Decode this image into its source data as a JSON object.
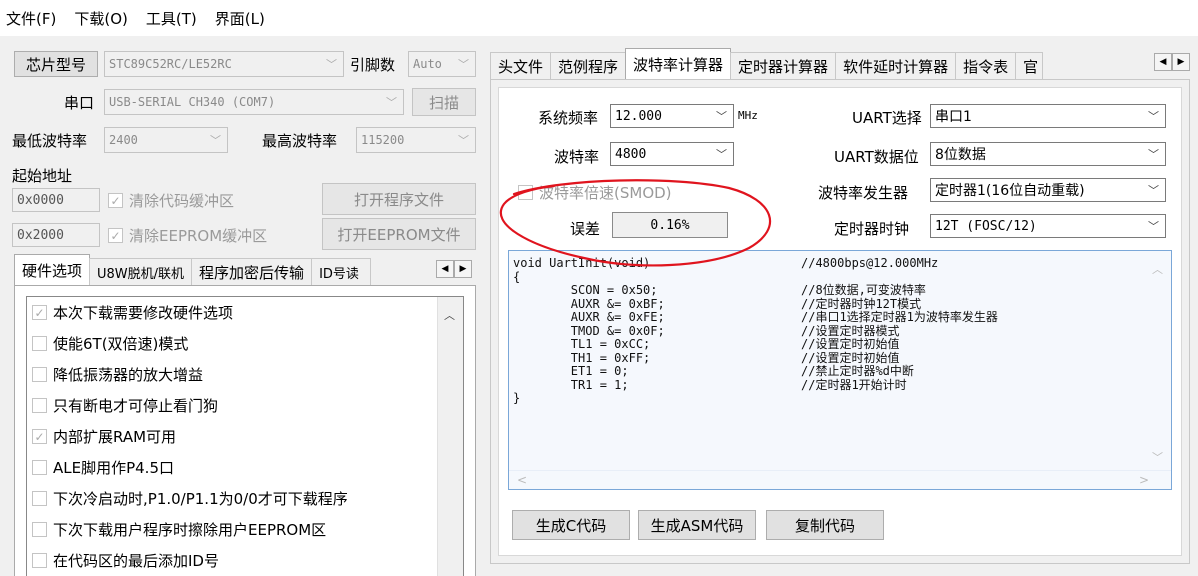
{
  "menu": [
    "文件(F)",
    "下载(O)",
    "工具(T)",
    "界面(L)"
  ],
  "left": {
    "chip_label": "芯片型号",
    "chip_value": "STC89C52RC/LE52RC",
    "pin_label": "引脚数",
    "pin_value": "Auto",
    "port_label": "串口",
    "port_value": "USB-SERIAL CH340 (COM7)",
    "scan_button": "扫描",
    "min_baud_label": "最低波特率",
    "min_baud_value": "2400",
    "max_baud_label": "最高波特率",
    "max_baud_value": "115200",
    "start_addr_label": "起始地址",
    "addr1": "0x0000",
    "clear_code_label": "清除代码缓冲区",
    "open_prog_button": "打开程序文件",
    "addr2": "0x2000",
    "clear_eeprom_label": "清除EEPROM缓冲区",
    "open_eeprom_button": "打开EEPROM文件",
    "tabs": [
      "硬件选项",
      "U8W脱机/联机",
      "程序加密后传输",
      "ID号读"
    ],
    "hw_options": [
      {
        "label": "本次下载需要修改硬件选项",
        "checked": true
      },
      {
        "label": "使能6T(双倍速)模式",
        "checked": false
      },
      {
        "label": "降低振荡器的放大增益",
        "checked": false
      },
      {
        "label": "只有断电才可停止看门狗",
        "checked": false
      },
      {
        "label": "内部扩展RAM可用",
        "checked": true
      },
      {
        "label": "ALE脚用作P4.5口",
        "checked": false
      },
      {
        "label": "下次冷启动时,P1.0/P1.1为0/0才可下载程序",
        "checked": false
      },
      {
        "label": "下次下载用户程序时擦除用户EEPROM区",
        "checked": false
      },
      {
        "label": "在代码区的最后添加ID号",
        "checked": false
      }
    ]
  },
  "right": {
    "tabs": [
      "头文件",
      "范例程序",
      "波特率计算器",
      "定时器计算器",
      "软件延时计算器",
      "指令表",
      "官"
    ],
    "sysfreq_label": "系统频率",
    "sysfreq_value": "12.000",
    "mhz": "MHz",
    "baud_label": "波特率",
    "baud_value": "4800",
    "double_label": "波特率倍速(SMOD)",
    "error_label": "误差",
    "error_value": "0.16%",
    "uart_sel_label": "UART选择",
    "uart_sel_value": "串口1",
    "uart_bits_label": "UART数据位",
    "uart_bits_value": "8位数据",
    "gen_label": "波特率发生器",
    "gen_value": "定时器1(16位自动重载)",
    "clock_label": "定时器时钟",
    "clock_value": "12T (FOSC/12)",
    "code_lines": [
      {
        "code": "void UartInit(void)",
        "comment": "//4800bps@12.000MHz"
      },
      {
        "code": "{",
        "comment": ""
      },
      {
        "code": "        SCON = 0x50;",
        "comment": "//8位数据,可变波特率"
      },
      {
        "code": "        AUXR &= 0xBF;",
        "comment": "//定时器时钟12T模式"
      },
      {
        "code": "        AUXR &= 0xFE;",
        "comment": "//串口1选择定时器1为波特率发生器"
      },
      {
        "code": "        TMOD &= 0x0F;",
        "comment": "//设置定时器模式"
      },
      {
        "code": "        TL1 = 0xCC;",
        "comment": "//设置定时初始值"
      },
      {
        "code": "        TH1 = 0xFF;",
        "comment": "//设置定时初始值"
      },
      {
        "code": "        ET1 = 0;",
        "comment": "//禁止定时器%d中断"
      },
      {
        "code": "        TR1 = 1;",
        "comment": "//定时器1开始计时"
      },
      {
        "code": "}",
        "comment": ""
      }
    ],
    "gen_c_button": "生成C代码",
    "gen_asm_button": "生成ASM代码",
    "copy_button": "复制代码"
  },
  "annotation_color": "#e0141e"
}
